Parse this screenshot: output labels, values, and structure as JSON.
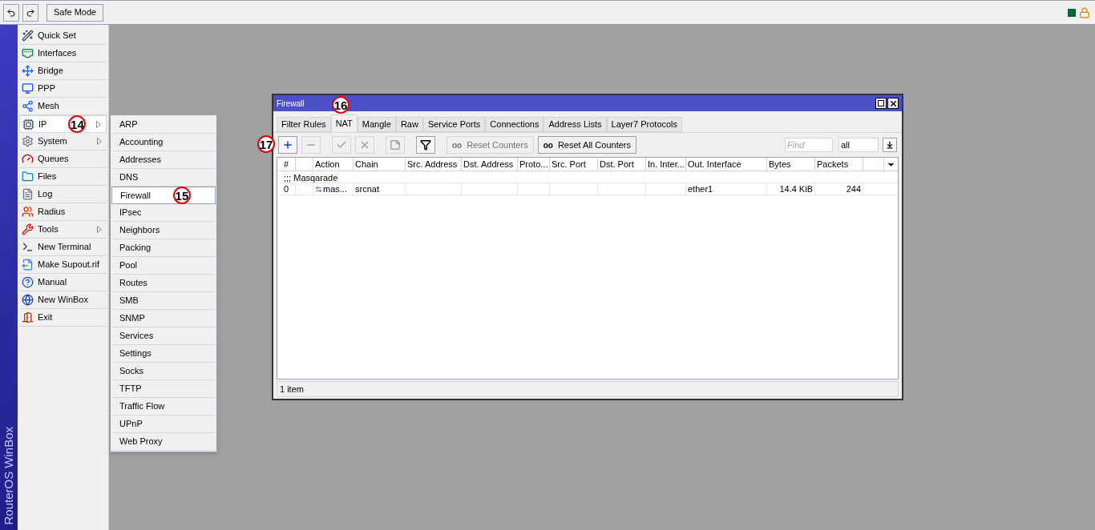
{
  "toolbar": {
    "safe_mode": "Safe Mode"
  },
  "brand": "RouterOS WinBox",
  "sidebar": {
    "items": [
      {
        "label": "Quick Set",
        "submenu": false,
        "selected": false
      },
      {
        "label": "Interfaces",
        "submenu": false,
        "selected": false
      },
      {
        "label": "Bridge",
        "submenu": false,
        "selected": false
      },
      {
        "label": "PPP",
        "submenu": false,
        "selected": false
      },
      {
        "label": "Mesh",
        "submenu": false,
        "selected": false
      },
      {
        "label": "IP",
        "submenu": true,
        "selected": true,
        "callout": "14"
      },
      {
        "label": "System",
        "submenu": true,
        "selected": false
      },
      {
        "label": "Queues",
        "submenu": false,
        "selected": false
      },
      {
        "label": "Files",
        "submenu": false,
        "selected": false
      },
      {
        "label": "Log",
        "submenu": false,
        "selected": false
      },
      {
        "label": "Radius",
        "submenu": false,
        "selected": false
      },
      {
        "label": "Tools",
        "submenu": true,
        "selected": false
      },
      {
        "label": "New Terminal",
        "submenu": false,
        "selected": false
      },
      {
        "label": "Make Supout.rif",
        "submenu": false,
        "selected": false
      },
      {
        "label": "Manual",
        "submenu": false,
        "selected": false
      },
      {
        "label": "New WinBox",
        "submenu": false,
        "selected": false
      },
      {
        "label": "Exit",
        "submenu": false,
        "selected": false
      }
    ]
  },
  "submenu": {
    "items": [
      {
        "label": "ARP",
        "selected": false
      },
      {
        "label": "Accounting",
        "selected": false
      },
      {
        "label": "Addresses",
        "selected": false
      },
      {
        "label": "DNS",
        "selected": false
      },
      {
        "label": "Firewall",
        "selected": true,
        "callout": "15"
      },
      {
        "label": "IPsec",
        "selected": false
      },
      {
        "label": "Neighbors",
        "selected": false
      },
      {
        "label": "Packing",
        "selected": false
      },
      {
        "label": "Pool",
        "selected": false
      },
      {
        "label": "Routes",
        "selected": false
      },
      {
        "label": "SMB",
        "selected": false
      },
      {
        "label": "SNMP",
        "selected": false
      },
      {
        "label": "Services",
        "selected": false
      },
      {
        "label": "Settings",
        "selected": false
      },
      {
        "label": "Socks",
        "selected": false
      },
      {
        "label": "TFTP",
        "selected": false
      },
      {
        "label": "Traffic Flow",
        "selected": false
      },
      {
        "label": "UPnP",
        "selected": false
      },
      {
        "label": "Web Proxy",
        "selected": false
      }
    ]
  },
  "window": {
    "title": "Firewall",
    "title_callout": "16",
    "tabs": [
      {
        "label": "Filter Rules",
        "selected": false
      },
      {
        "label": "NAT",
        "selected": true
      },
      {
        "label": "Mangle",
        "selected": false
      },
      {
        "label": "Raw",
        "selected": false
      },
      {
        "label": "Service Ports",
        "selected": false
      },
      {
        "label": "Connections",
        "selected": false
      },
      {
        "label": "Address Lists",
        "selected": false
      },
      {
        "label": "Layer7 Protocols",
        "selected": false
      }
    ],
    "toolbar": {
      "callout": "17",
      "add_disabled": false,
      "remove_disabled": true,
      "enable_disabled": true,
      "disable_disabled": true,
      "comment_disabled": true,
      "filter_disabled": false,
      "reset_counters": {
        "glyph": "oo",
        "label": "Reset Counters",
        "disabled": true
      },
      "reset_all_counters": {
        "glyph": "oo",
        "label": "Reset All Counters",
        "disabled": false
      },
      "find": {
        "placeholder": "Find"
      },
      "scope": "all"
    },
    "table": {
      "columns": [
        "#",
        "",
        "Action",
        "Chain",
        "Src. Address",
        "Dst. Address",
        "Proto...",
        "Src. Port",
        "Dst. Port",
        "In. Inter...",
        "Out. Interface",
        "Bytes",
        "Packets"
      ],
      "rows": [
        {
          "kind": "comment",
          "comment": ";;; Masqarade"
        },
        {
          "kind": "rule",
          "cells": [
            "0",
            "",
            "mas...",
            "srcnat",
            "",
            "",
            "",
            "",
            "",
            "",
            "ether1",
            "14.4 KiB",
            "244"
          ]
        }
      ]
    },
    "status_bar": "1 item"
  }
}
